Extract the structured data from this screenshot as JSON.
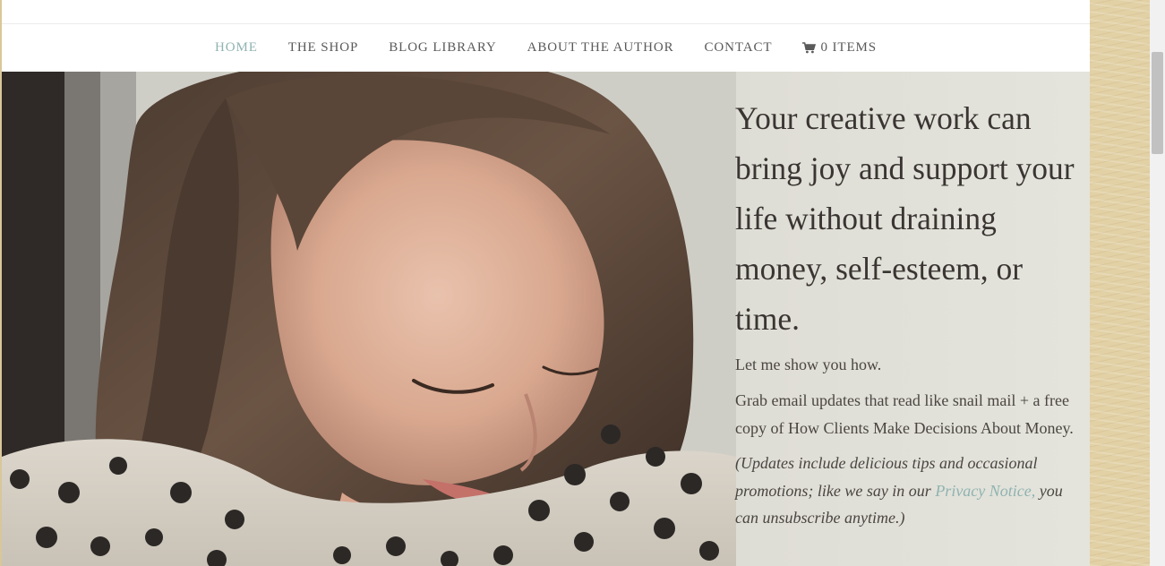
{
  "nav": {
    "items": [
      {
        "label": "HOME",
        "active": true
      },
      {
        "label": "THE SHOP",
        "active": false
      },
      {
        "label": "BLOG LIBRARY",
        "active": false
      },
      {
        "label": "ABOUT THE AUTHOR",
        "active": false
      },
      {
        "label": "CONTACT",
        "active": false
      }
    ],
    "cart_label": "0 ITEMS",
    "cart_icon": "shopping-cart-icon"
  },
  "hero": {
    "headline": "Your creative work can bring joy and support your life without draining money, self-esteem, or time.",
    "subheadline": "Let me show you how.",
    "body": "Grab email updates that read like snail mail + a free copy of How Clients Make Decisions About Money.",
    "note_prefix": "(Updates include delicious tips and occasional promotions; like we say in our ",
    "note_link": "Privacy Notice,",
    "note_suffix": " you can unsubscribe anytime.)"
  },
  "colors": {
    "accent": "#8fb3b1",
    "text": "#3f3a36",
    "parchment": "#e2d1a5"
  }
}
